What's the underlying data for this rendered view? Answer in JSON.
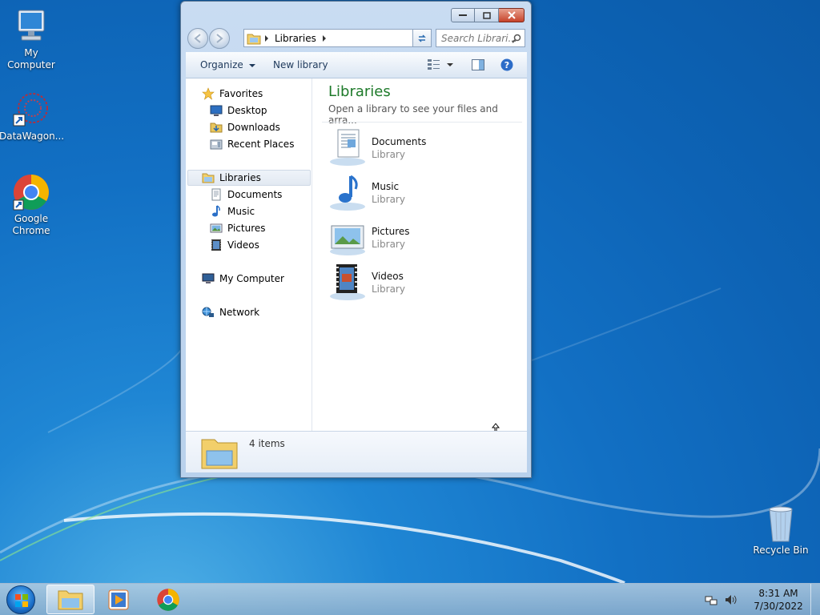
{
  "desktop": {
    "icons": [
      {
        "label": "My Computer"
      },
      {
        "label": "DataWagon..."
      },
      {
        "label": "Google Chrome"
      },
      {
        "label": "Recycle Bin"
      }
    ]
  },
  "window": {
    "address": "Libraries",
    "search_placeholder": "Search Librari...",
    "toolbar": {
      "organize": "Organize",
      "new_library": "New library"
    },
    "nav": {
      "favorites": "Favorites",
      "desktop": "Desktop",
      "downloads": "Downloads",
      "recent_places": "Recent Places",
      "libraries": "Libraries",
      "documents": "Documents",
      "music": "Music",
      "pictures": "Pictures",
      "videos": "Videos",
      "my_computer": "My Computer",
      "network": "Network"
    },
    "main": {
      "title": "Libraries",
      "subtitle": "Open a library to see your files and arra...",
      "libraries": [
        {
          "name": "Documents",
          "type": "Library"
        },
        {
          "name": "Music",
          "type": "Library"
        },
        {
          "name": "Pictures",
          "type": "Library"
        },
        {
          "name": "Videos",
          "type": "Library"
        }
      ]
    },
    "details": {
      "count": "4 items"
    }
  },
  "taskbar": {
    "time": "8:31 AM",
    "date": "7/30/2022"
  },
  "colors": {
    "library_title": "#1e7a2a",
    "taskbar": "#a8c3dc",
    "desktop": "#1270c4"
  }
}
